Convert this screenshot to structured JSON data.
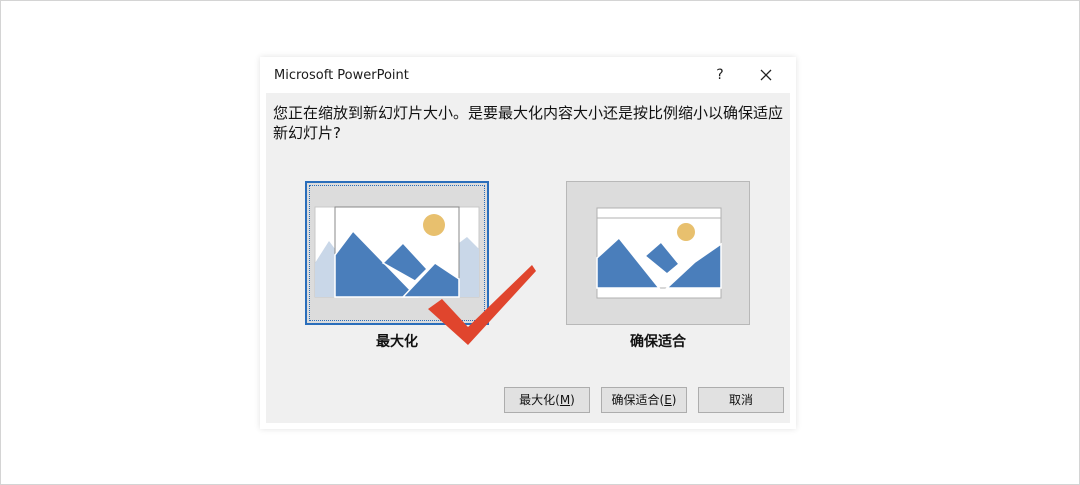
{
  "window": {
    "title": "Microsoft PowerPoint",
    "help": "?"
  },
  "message": "您正在缩放到新幻灯片大小。是要最大化内容大小还是按比例缩小以确保适应新幻灯片?",
  "options": [
    {
      "label": "最大化",
      "selected": true
    },
    {
      "label": "确保适合",
      "selected": false
    }
  ],
  "buttons": {
    "maximize": {
      "text": "最大化(",
      "key": "M",
      "suffix": ")"
    },
    "ensure_fit": {
      "text": "确保适合(",
      "key": "E",
      "suffix": ")"
    },
    "cancel": "取消"
  },
  "colors": {
    "accent": "#2a6ebb",
    "mountain": "#4a7ebb",
    "mountain_light": "#c9d7e8",
    "sun": "#e8c06e",
    "check": "#e0452d",
    "dialog_bg": "#f0f0f0"
  },
  "icons": [
    "close-icon",
    "check-mark-icon",
    "picture-icon"
  ]
}
